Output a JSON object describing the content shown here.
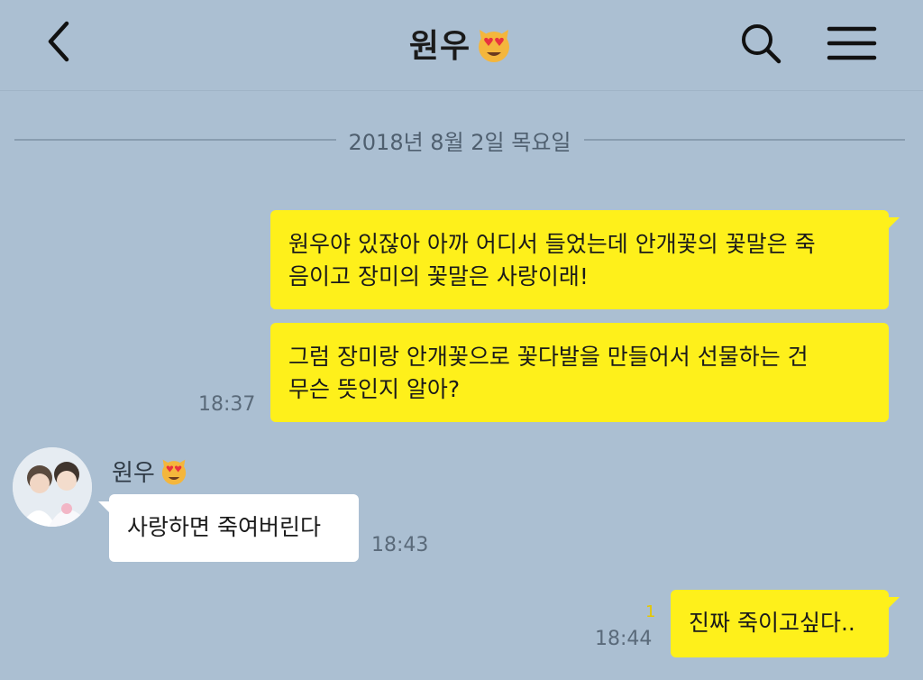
{
  "header": {
    "title": "원우",
    "title_emoji_icon": "heart-eyes-cat-icon",
    "back_icon": "chevron-left-icon",
    "search_icon": "search-icon",
    "menu_icon": "hamburger-menu-icon"
  },
  "date_divider": "2018년 8월 2일 목요일",
  "messages": [
    {
      "sender": "me",
      "lines": [
        "원우야 있잖아 아까 어디서 들었는데 안개꽃의 꽃말은 죽",
        "음이고 장미의 꽃말은 사랑이래!"
      ]
    },
    {
      "sender": "me",
      "lines": [
        "그럼 장미랑 안개꽃으로 꽃다발을 만들어서 선물하는 건",
        "무슨 뜻인지 알아?"
      ],
      "time": "18:37"
    },
    {
      "sender": "them",
      "name": "원우",
      "text": "사랑하면 죽여버린다",
      "time": "18:43"
    },
    {
      "sender": "me",
      "text": "진짜 죽이고싶다..",
      "unread": "1",
      "time": "18:44"
    }
  ],
  "colors": {
    "background": "#abbfd2",
    "my_bubble": "#fef01b",
    "their_bubble": "#ffffff"
  }
}
